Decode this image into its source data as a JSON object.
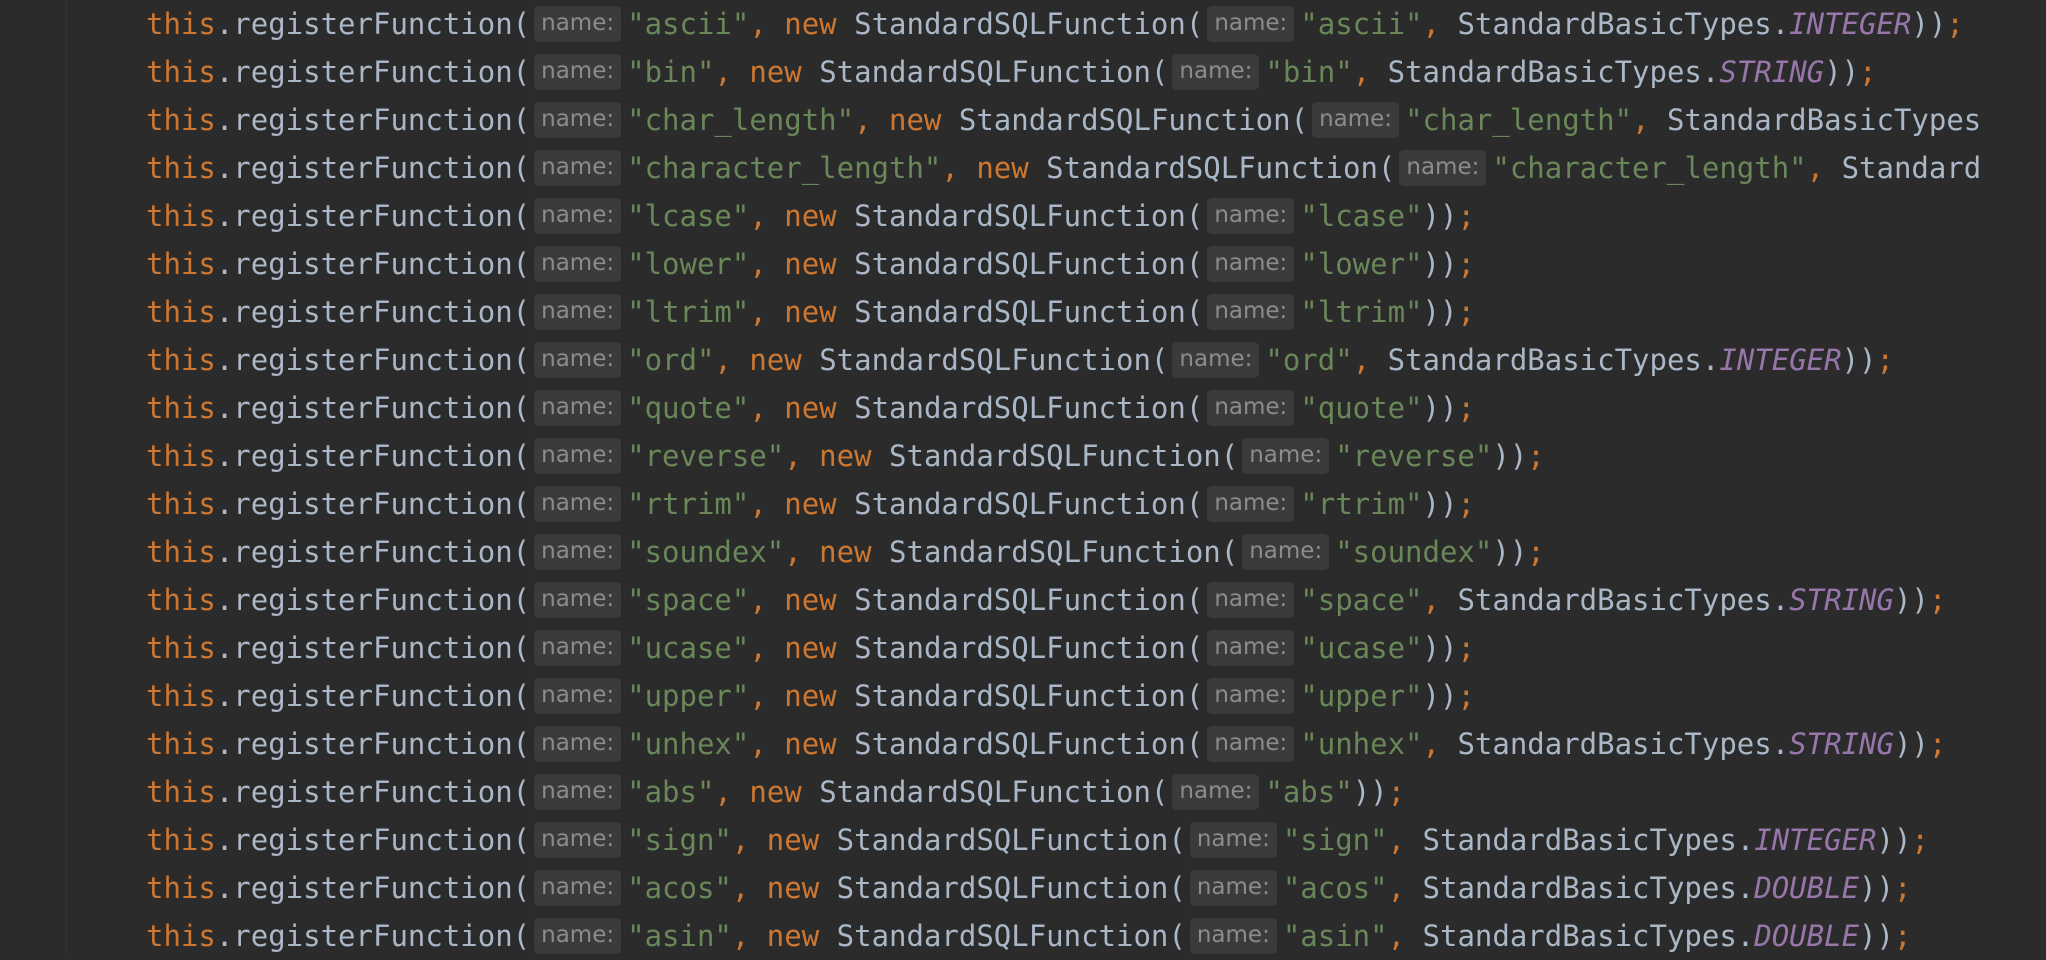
{
  "editor": {
    "keyword_this": "this",
    "method": ".registerFunction(",
    "keyword_new": "new",
    "ctor": "StandardSQLFunction(",
    "hint_label": "name:",
    "types_class": "StandardBasicTypes.",
    "close_semi": ";",
    "lines": [
      {
        "name": "\"ascii\"",
        "type": "INTEGER",
        "tail": "))"
      },
      {
        "name": "\"bin\"",
        "type": "STRING",
        "tail": "))"
      },
      {
        "name": "\"char_length\"",
        "type": "",
        "tail": "",
        "truncated": "StandardBasicTypes"
      },
      {
        "name": "\"character_length\"",
        "type": "",
        "tail": "",
        "truncated": "Standard"
      },
      {
        "name": "\"lcase\"",
        "type": "",
        "tail": "))"
      },
      {
        "name": "\"lower\"",
        "type": "",
        "tail": "))"
      },
      {
        "name": "\"ltrim\"",
        "type": "",
        "tail": "))"
      },
      {
        "name": "\"ord\"",
        "type": "INTEGER",
        "tail": "))"
      },
      {
        "name": "\"quote\"",
        "type": "",
        "tail": "))"
      },
      {
        "name": "\"reverse\"",
        "type": "",
        "tail": "))"
      },
      {
        "name": "\"rtrim\"",
        "type": "",
        "tail": "))"
      },
      {
        "name": "\"soundex\"",
        "type": "",
        "tail": "))"
      },
      {
        "name": "\"space\"",
        "type": "STRING",
        "tail": "))"
      },
      {
        "name": "\"ucase\"",
        "type": "",
        "tail": "))"
      },
      {
        "name": "\"upper\"",
        "type": "",
        "tail": "))"
      },
      {
        "name": "\"unhex\"",
        "type": "STRING",
        "tail": "))"
      },
      {
        "name": "\"abs\"",
        "type": "",
        "tail": "))"
      },
      {
        "name": "\"sign\"",
        "type": "INTEGER",
        "tail": "))"
      },
      {
        "name": "\"acos\"",
        "type": "DOUBLE",
        "tail": "))"
      },
      {
        "name": "\"asin\"",
        "type": "DOUBLE",
        "tail": "))"
      }
    ]
  },
  "colors": {
    "background": "#2b2b2b",
    "keyword": "#cc7832",
    "string": "#6a8759",
    "constant": "#9876aa",
    "text": "#a9b7c6",
    "hint_bg": "#3b3b3b",
    "hint_text": "#8c8c8c"
  }
}
